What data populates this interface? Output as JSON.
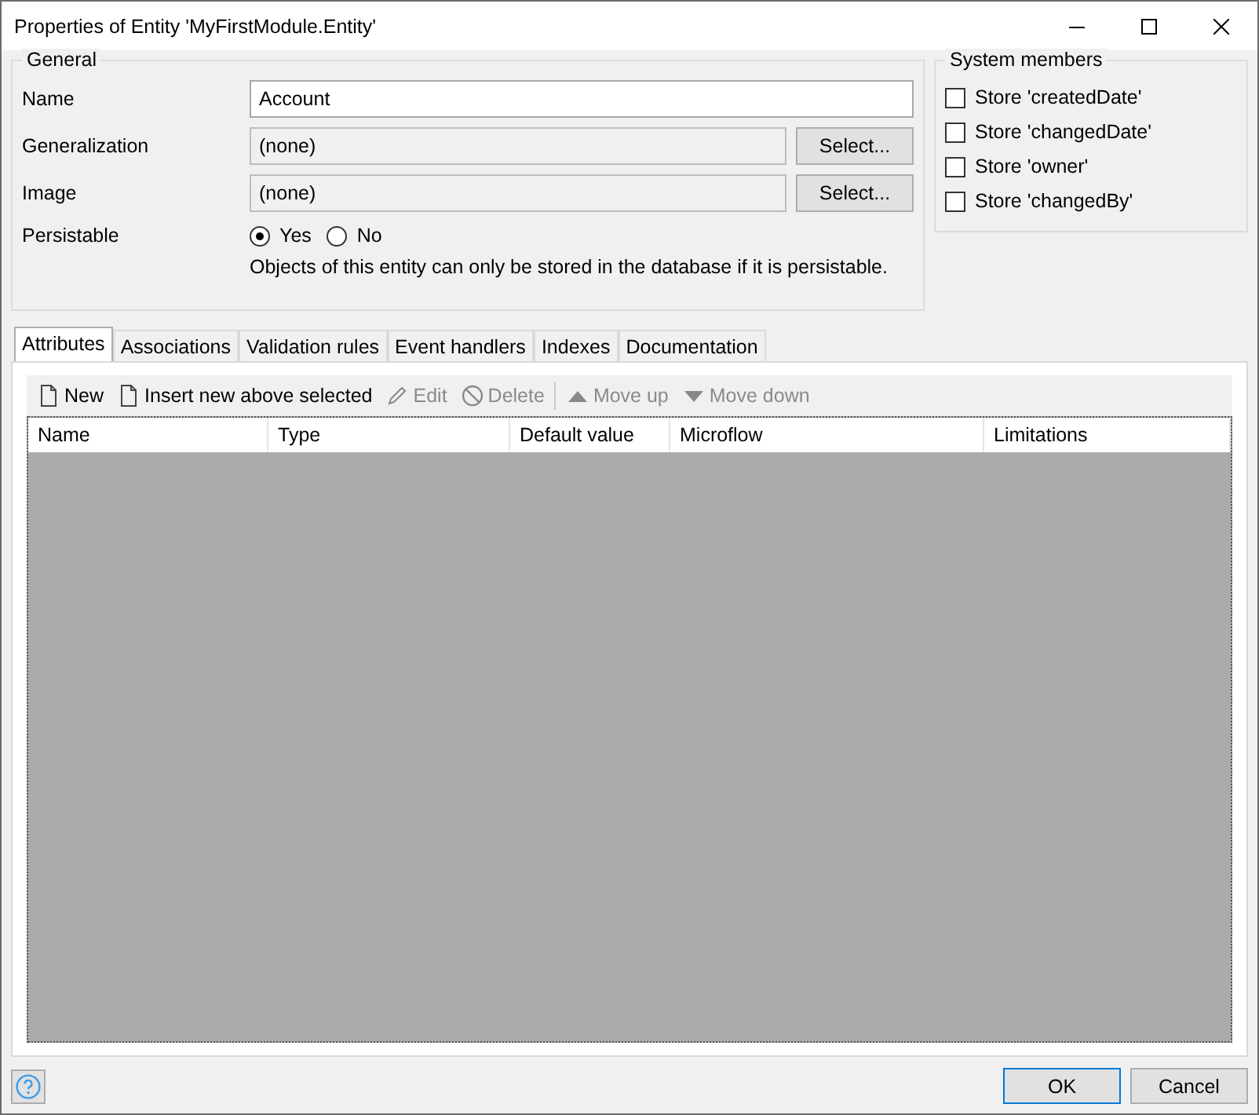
{
  "window": {
    "title": "Properties of Entity 'MyFirstModule.Entity'"
  },
  "general": {
    "title": "General",
    "fields": [
      {
        "label": "Name",
        "value": "Account",
        "readonly": false
      },
      {
        "label": "Generalization",
        "value": "(none)",
        "readonly": true,
        "button": "Select..."
      },
      {
        "label": "Image",
        "value": "(none)",
        "readonly": true,
        "button": "Select..."
      }
    ],
    "persistable": {
      "label": "Persistable",
      "options": [
        {
          "label": "Yes",
          "selected": true
        },
        {
          "label": "No",
          "selected": false
        }
      ],
      "note": "Objects of this entity can only be stored in the database if it is persistable."
    }
  },
  "system_members": {
    "title": "System members",
    "items": [
      {
        "label": "Store 'createdDate'",
        "checked": false
      },
      {
        "label": "Store 'changedDate'",
        "checked": false
      },
      {
        "label": "Store 'owner'",
        "checked": false
      },
      {
        "label": "Store 'changedBy'",
        "checked": false
      }
    ]
  },
  "tabs": [
    {
      "label": "Attributes",
      "selected": true
    },
    {
      "label": "Associations",
      "selected": false
    },
    {
      "label": "Validation rules",
      "selected": false
    },
    {
      "label": "Event handlers",
      "selected": false
    },
    {
      "label": "Indexes",
      "selected": false
    },
    {
      "label": "Documentation",
      "selected": false
    }
  ],
  "toolbar": [
    {
      "kind": "new",
      "label": "New",
      "disabled": false
    },
    {
      "kind": "new",
      "label": "Insert new above selected",
      "disabled": false
    },
    {
      "kind": "edit",
      "label": "Edit",
      "disabled": true
    },
    {
      "kind": "delete",
      "label": "Delete",
      "disabled": true
    },
    {
      "kind": "up",
      "label": "Move up",
      "disabled": true
    },
    {
      "kind": "down",
      "label": "Move down",
      "disabled": true
    }
  ],
  "table": {
    "columns": [
      "Name",
      "Type",
      "Default value",
      "Microflow",
      "Limitations"
    ]
  },
  "buttons": [
    {
      "label": "OK",
      "default": true
    },
    {
      "label": "Cancel",
      "default": false
    }
  ]
}
